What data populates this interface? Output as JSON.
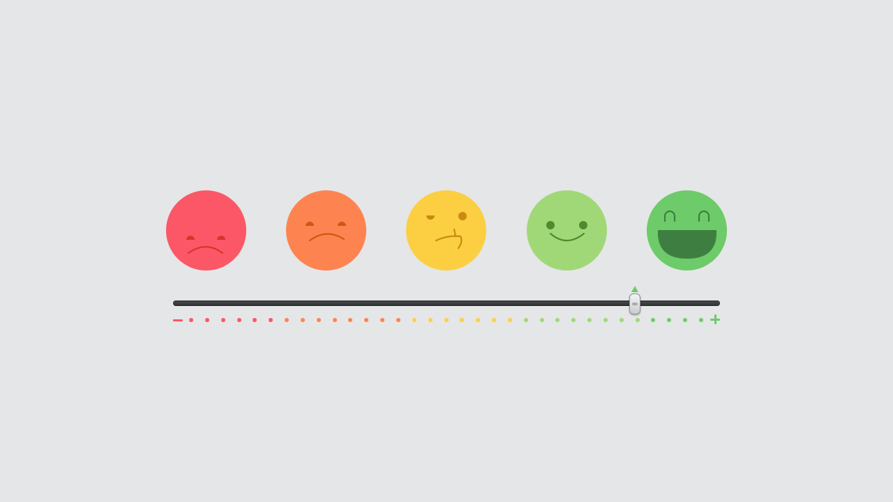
{
  "rating_widget": {
    "faces": [
      {
        "name": "very-sad-face",
        "color": "#fc5766",
        "feature_color": "#d9342b"
      },
      {
        "name": "sad-face",
        "color": "#fd8450",
        "feature_color": "#c95b10"
      },
      {
        "name": "skeptical-face",
        "color": "#fccf42",
        "feature_color": "#c98a12"
      },
      {
        "name": "happy-face",
        "color": "#a1d877",
        "feature_color": "#4e8a2f"
      },
      {
        "name": "very-happy-face",
        "color": "#6dcb6a",
        "feature_color": "#3e7f41"
      }
    ],
    "slider": {
      "value": 0.85,
      "min_icon": "minus-icon",
      "max_icon": "plus-icon",
      "tick_count": 33,
      "pointer_color": "#6dcb6a"
    }
  }
}
